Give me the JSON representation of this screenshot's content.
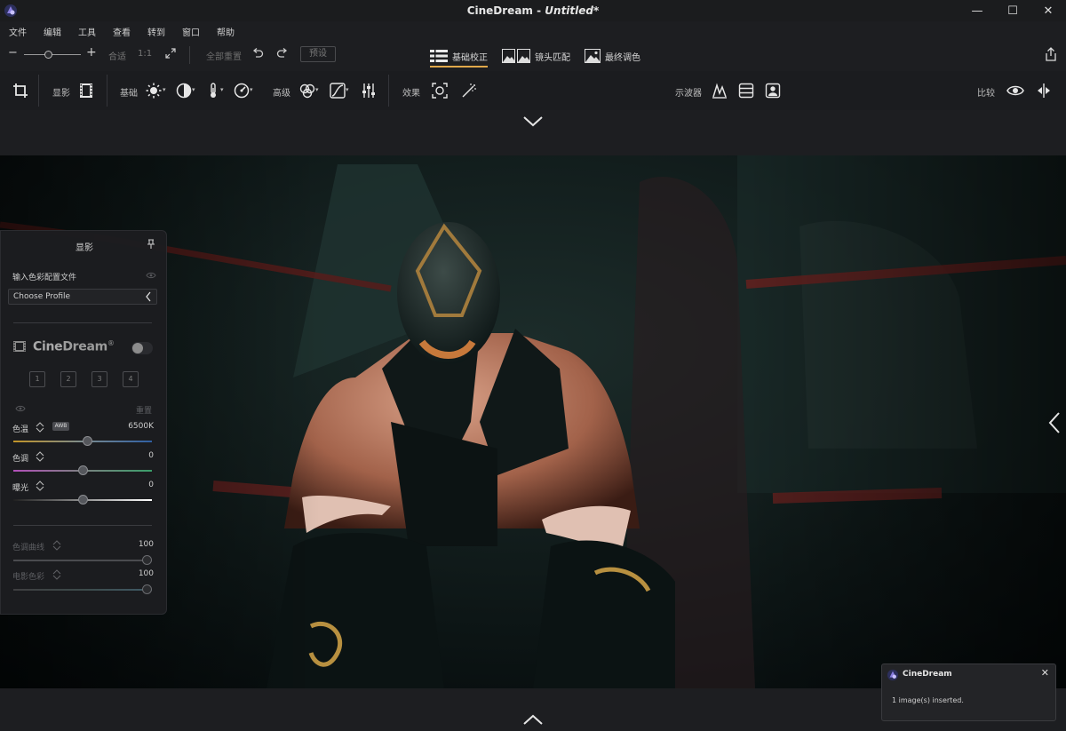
{
  "app": {
    "name": "CineDream",
    "title_sep": " - ",
    "doc": "Untitled*"
  },
  "window": {
    "minimize": "—",
    "maximize": "☐",
    "close": "✕"
  },
  "menu": [
    "文件",
    "编辑",
    "工具",
    "查看",
    "转到",
    "窗口",
    "帮助"
  ],
  "toolbar": {
    "zoom_minus": "−",
    "zoom_plus": "+",
    "fit": "合适",
    "one_to_one": "1:1",
    "reset_all": "全部重置",
    "preset": "预设"
  },
  "modes": [
    {
      "label": "基础校正",
      "active": true
    },
    {
      "label": "镜头匹配",
      "active": false
    },
    {
      "label": "最终调色",
      "active": false
    }
  ],
  "panel_tools": {
    "film": "显影",
    "basic": "基础",
    "advanced": "高级",
    "effects": "效果",
    "scopes": "示波器",
    "compare": "比较"
  },
  "panel": {
    "title": "显影",
    "input_profile": "输入色彩配置文件",
    "profile_placeholder": "Choose Profile",
    "brand_a": "Cine",
    "brand_b": "Dream",
    "brand_mark": "®",
    "slots": [
      "1",
      "2",
      "3",
      "4"
    ],
    "reset": "重置",
    "awb": "AWB",
    "sliders": [
      {
        "label": "色温",
        "value": "6500K",
        "level": 0.54,
        "enabled": true
      },
      {
        "label": "色调",
        "value": "0",
        "level": 0.5,
        "enabled": true
      },
      {
        "label": "曝光",
        "value": "0",
        "level": 0.5,
        "enabled": true
      }
    ],
    "curves": [
      {
        "label": "色调曲线",
        "value": "100",
        "level": 1.0,
        "enabled": false
      },
      {
        "label": "电影色彩",
        "value": "100",
        "level": 1.0,
        "enabled": false
      }
    ]
  },
  "toast": {
    "title": "CineDream",
    "message": "1 image(s) inserted.",
    "close": "✕"
  },
  "colors": {
    "accent": "#e0a84a",
    "background": "#1d1e21",
    "panel": "#1c1d20"
  }
}
